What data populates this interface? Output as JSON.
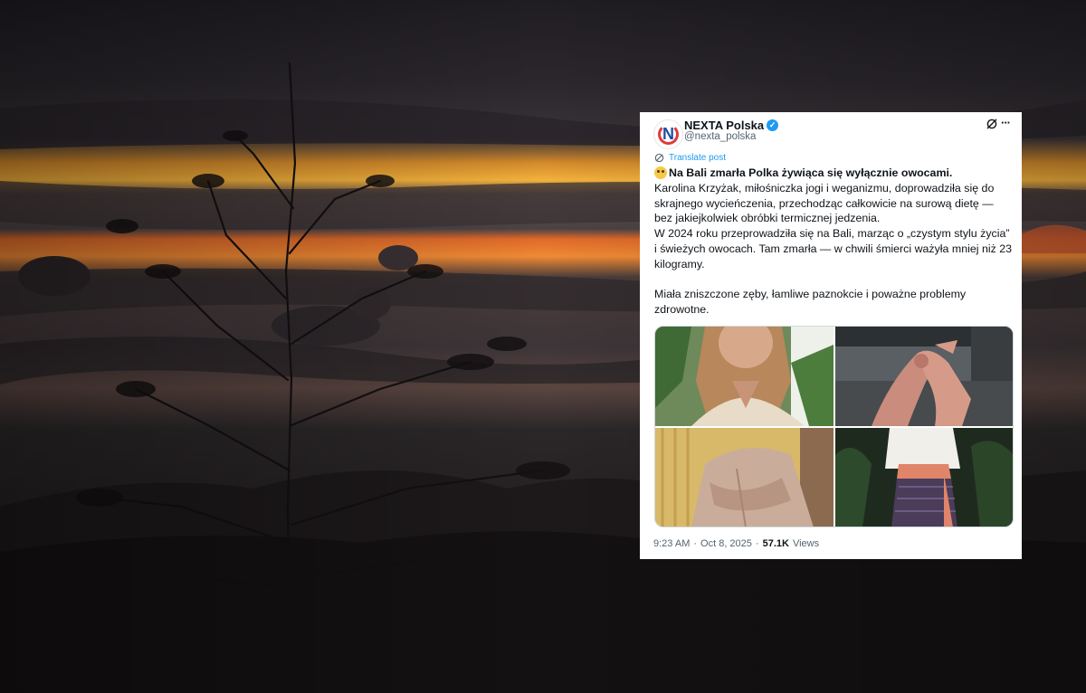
{
  "post": {
    "display_name": "NEXTA Polska",
    "handle": "@nexta_polska",
    "avatar_letter": "N",
    "verified_mark": "✓",
    "more_label": "···",
    "translate_label": "Translate post",
    "headline": "Na Bali zmarła Polka żywiąca się wyłącznie owocami.",
    "paragraph1": "Karolina Krzyżak, miłośniczka jogi i weganizmu, doprowadziła się do skrajnego wycieńczenia, przechodząc całkowicie na surową dietę — bez jakiejkolwiek obróbki termicznej jedzenia.",
    "paragraph2": "W 2024 roku przeprowadziła się na Bali, marząc o „czystym stylu życia” i świeżych owocach. Tam zmarła — w chwili śmierci ważyła mniej niż 23 kilogramy.",
    "paragraph3": "Miała zniszczone zęby, łamliwe paznokcie i poważne problemy zdrowotne.",
    "time": "9:23 AM",
    "separator": "·",
    "date": "Oct 8, 2025",
    "views_count": "57.1K",
    "views_label": "Views"
  },
  "icons": {
    "verified": "verified-badge-icon",
    "grok": "grok-icon",
    "more": "more-icon",
    "translate": "translate-icon",
    "emoji": "flushed-face-icon"
  },
  "colors": {
    "accent": "#1d9bf0",
    "text": "#0f1419",
    "muted": "#536471",
    "card_bg": "#ffffff"
  }
}
